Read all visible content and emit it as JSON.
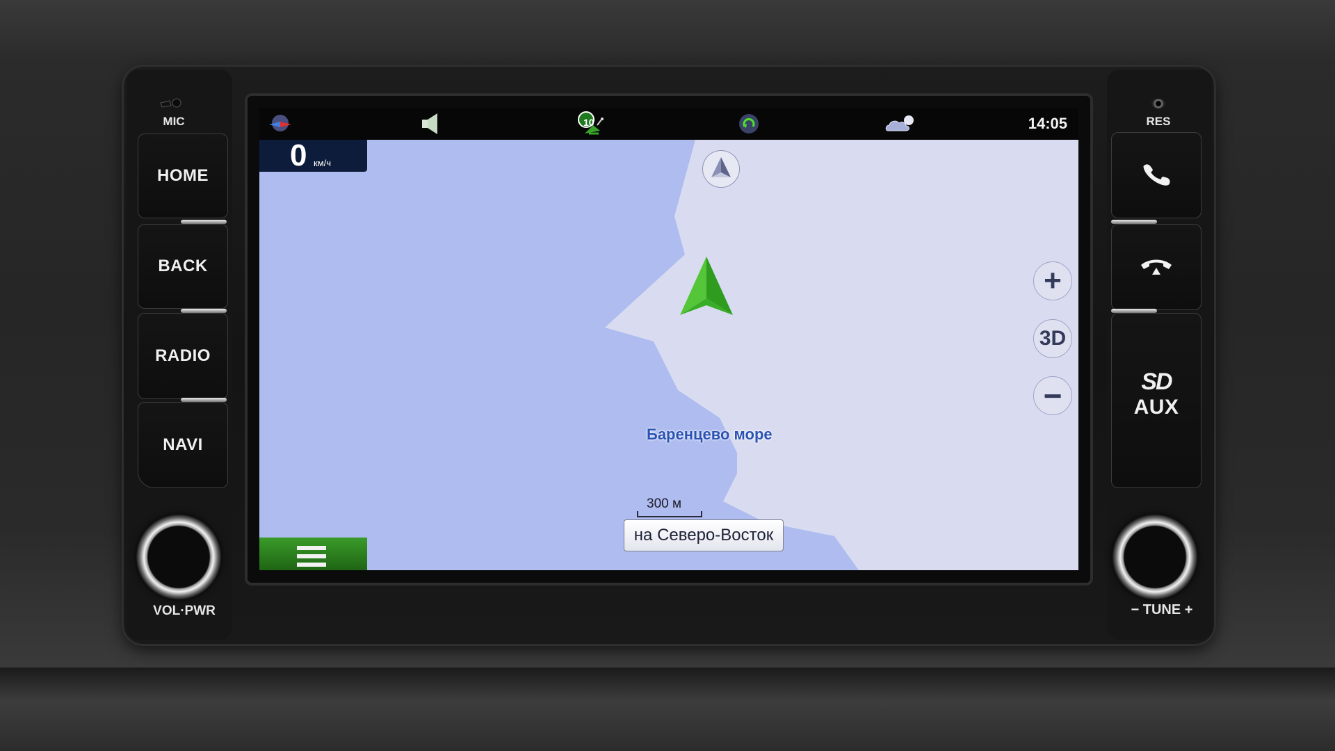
{
  "device": {
    "left_buttons": [
      {
        "id": "home",
        "label": "HOME"
      },
      {
        "id": "back",
        "label": "BACK"
      },
      {
        "id": "radio",
        "label": "RADIO"
      },
      {
        "id": "navi",
        "label": "NAVI"
      }
    ],
    "mic_label": "MIC",
    "res_label": "RES",
    "right_buttons": [
      {
        "id": "call",
        "icon": "phone-answer-icon"
      },
      {
        "id": "hangup",
        "icon": "phone-hangup-icon"
      },
      {
        "id": "sd-aux",
        "logo": "SD",
        "label": "AUX"
      }
    ],
    "vol_knob_label": "VOL·PWR",
    "tune_knob_label": "− TUNE +"
  },
  "statusbar": {
    "icons": [
      "compass-globe-icon",
      "speaker-icon",
      "gps-satellite-icon",
      "sync-icon",
      "weather-cloud-icon"
    ],
    "satellite_count": "10",
    "time": "14:05"
  },
  "map": {
    "speed": {
      "value": "0",
      "unit": "км/ч"
    },
    "sea_label": "Баренцево море",
    "scale_label": "300 м",
    "direction_label": "на Северо-Восток",
    "zoom_in_label": "+",
    "mode_label": "3D",
    "zoom_out_label": "−",
    "colors": {
      "water": "#aebcef",
      "land": "#d9dcf0",
      "position_marker": "#3fb52c",
      "menu_button": "#2f8a22"
    }
  }
}
